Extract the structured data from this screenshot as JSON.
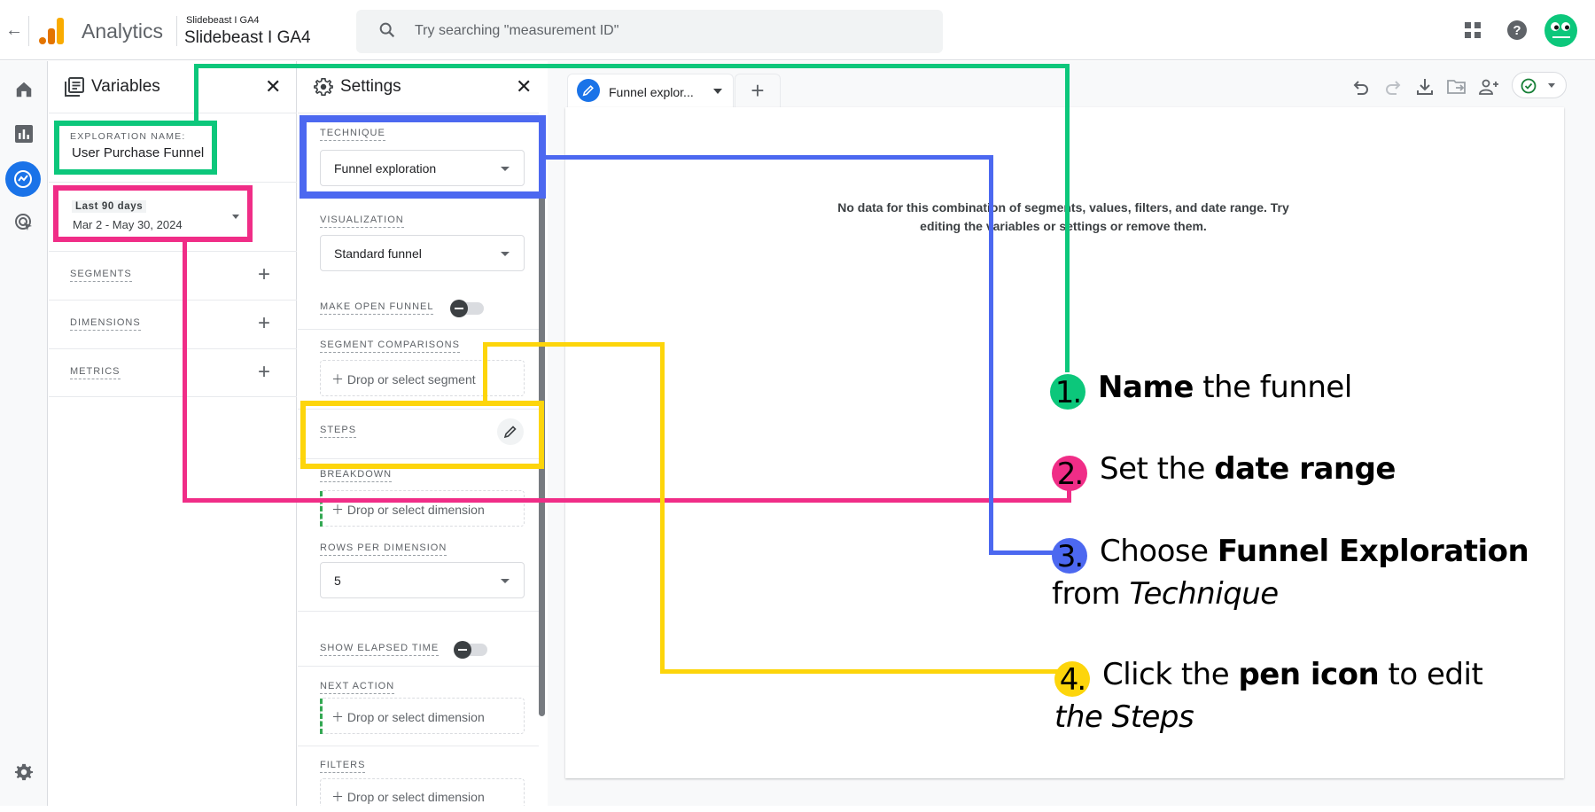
{
  "topbar": {
    "back_icon": "arrow-back-icon",
    "app_name": "Analytics",
    "account_small": "Slidebeast I GA4",
    "account_big": "Slidebeast I GA4",
    "search_placeholder": "Try searching \"measurement ID\"",
    "icons": [
      "apps-grid-icon",
      "help-icon",
      "avatar"
    ]
  },
  "leftnav": {
    "items": [
      {
        "icon": "home-icon",
        "label": "Home"
      },
      {
        "icon": "reports-icon",
        "label": "Reports"
      },
      {
        "icon": "explore-icon",
        "label": "Explore",
        "active": true
      },
      {
        "icon": "advertising-icon",
        "label": "Advertising"
      }
    ],
    "settings_icon": "admin-gear-icon"
  },
  "variables": {
    "title": "Variables",
    "exploration_name_label": "EXPLORATION NAME:",
    "exploration_name_value": "User Purchase Funnel",
    "date_chip": "Last 90 days",
    "date_range": "Mar 2 - May 30, 2024",
    "sections": [
      {
        "label": "SEGMENTS"
      },
      {
        "label": "DIMENSIONS"
      },
      {
        "label": "METRICS"
      }
    ]
  },
  "settings": {
    "title": "Settings",
    "technique_label": "TECHNIQUE",
    "technique_value": "Funnel exploration",
    "visualization_label": "VISUALIZATION",
    "visualization_value": "Standard funnel",
    "open_funnel_label": "MAKE OPEN FUNNEL",
    "open_funnel_on": false,
    "segment_comparisons_label": "SEGMENT COMPARISONS",
    "segment_drop": "Drop or select segment",
    "steps_label": "STEPS",
    "breakdown_label": "BREAKDOWN",
    "breakdown_drop": "Drop or select dimension",
    "rows_label": "ROWS PER DIMENSION",
    "rows_value": "5",
    "elapsed_label": "SHOW ELAPSED TIME",
    "elapsed_on": false,
    "next_action_label": "NEXT ACTION",
    "next_action_drop": "Drop or select dimension",
    "filters_label": "FILTERS",
    "filters_drop": "Drop or select dimension"
  },
  "canvas": {
    "tab_name": "Funnel explor...",
    "add_tab": "+",
    "no_data_message": "No data for this combination of segments, values, filters, and date range. Try editing the variables or settings or remove them.",
    "toolbar": [
      "undo-icon",
      "redo-icon",
      "download-icon",
      "move-to-folder-icon",
      "share-icon",
      "status-check-icon"
    ]
  },
  "annotations": {
    "colors": {
      "green": "#0cc77b",
      "pink": "#f02d87",
      "blue": "#4c68f0",
      "yellow": "#fdd50b"
    },
    "steps": [
      {
        "num": "1.",
        "pre": "",
        "bold": "Name",
        "post": " the funnel",
        "line2_pre": "",
        "line2_italic": ""
      },
      {
        "num": "2.",
        "pre": "Set the ",
        "bold": "date range",
        "post": "",
        "line2_pre": "",
        "line2_italic": ""
      },
      {
        "num": "3.",
        "pre": "Choose ",
        "bold": "Funnel Exploration",
        "post": "",
        "line2_pre": "from ",
        "line2_italic": "Technique"
      },
      {
        "num": "4.",
        "pre": "Click the ",
        "bold": "pen icon",
        "post": " to edit",
        "line2_pre": "",
        "line2_italic": "the Steps"
      }
    ]
  }
}
